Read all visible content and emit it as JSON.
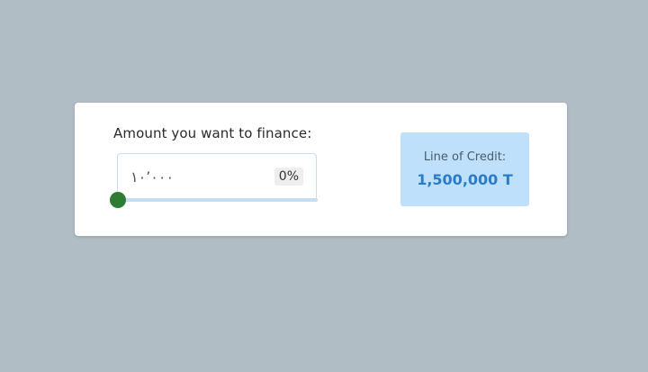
{
  "form": {
    "amount_label": "Amount you want to finance:",
    "amount_value": "۱۰٬۰۰۰",
    "percent_badge": "0%",
    "slider_value_percent": 0
  },
  "credit": {
    "label": "Line of Credit:",
    "value": "1,500,000 T"
  },
  "colors": {
    "background": "#b1bdc5",
    "slider_accent": "#2e7d32",
    "credit_box_bg": "#bfe0fb",
    "credit_value": "#2a7cc9",
    "input_border": "#c7ddf0"
  }
}
